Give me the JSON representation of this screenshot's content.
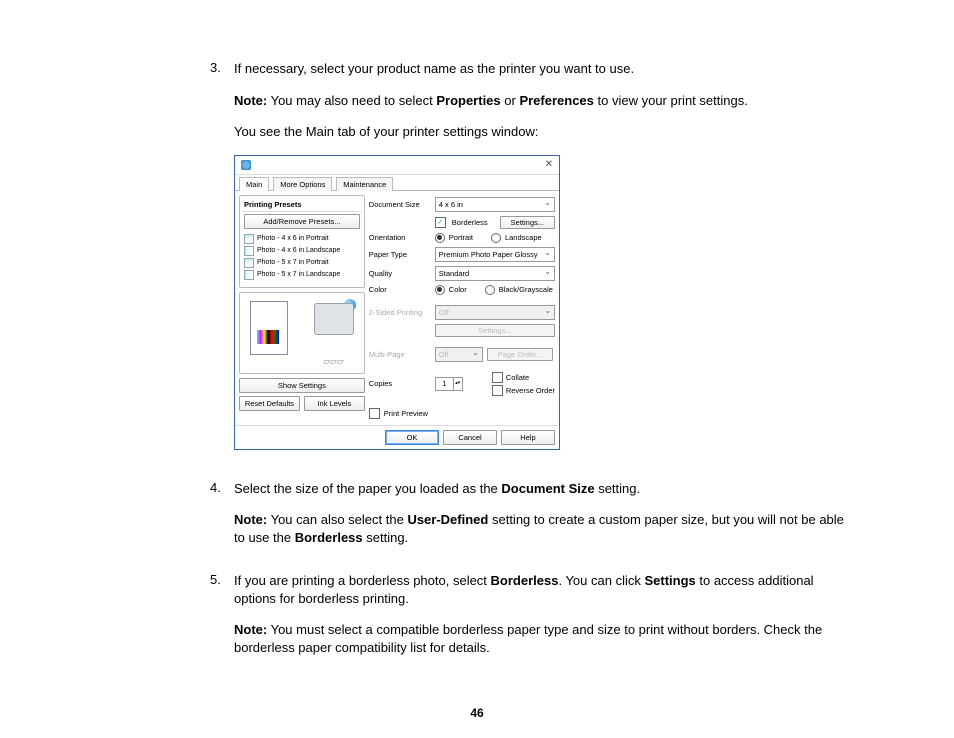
{
  "steps": {
    "s3": {
      "num": "3.",
      "text": "If necessary, select your product name as the printer you want to use.",
      "note_label": "Note:",
      "note_a": " You may also need to select ",
      "note_b": "Properties",
      "note_c": " or ",
      "note_d": "Preferences",
      "note_e": " to view your print settings.",
      "after": "You see the Main tab of your printer settings window:"
    },
    "s4": {
      "num": "4.",
      "text_a": "Select the size of the paper you loaded as the ",
      "text_b": "Document Size",
      "text_c": " setting.",
      "note_label": "Note:",
      "note_a": " You can also select the ",
      "note_b": "User-Defined",
      "note_c": " setting to create a custom paper size, but you will not be able to use the ",
      "note_d": "Borderless",
      "note_e": " setting."
    },
    "s5": {
      "num": "5.",
      "text_a": "If you are printing a borderless photo, select ",
      "text_b": "Borderless",
      "text_c": ". You can click ",
      "text_d": "Settings",
      "text_e": " to access additional options for borderless printing.",
      "note_label": "Note:",
      "note_a": " You must select a compatible borderless paper type and size to print without borders. Check the borderless paper compatibility list for details."
    }
  },
  "dialog": {
    "tabs": {
      "main": "Main",
      "more": "More Options",
      "maint": "Maintenance"
    },
    "presets_title": "Printing Presets",
    "add_remove": "Add/Remove Presets...",
    "presets": [
      "Photo - 4 x 6 in Portrait",
      "Photo - 4 x 6 in Landscape",
      "Photo - 5 x 7 in Portrait",
      "Photo - 5 x 7 in Landscape"
    ],
    "show_settings": "Show Settings",
    "reset_defaults": "Reset Defaults",
    "ink_levels": "Ink Levels",
    "labels": {
      "doc_size": "Document Size",
      "borderless": "Borderless",
      "settings": "Settings...",
      "orientation": "Orientation",
      "portrait": "Portrait",
      "landscape": "Landscape",
      "paper_type": "Paper Type",
      "quality": "Quality",
      "color": "Color",
      "color_opt": "Color",
      "bw_opt": "Black/Grayscale",
      "twosided": "2-Sided Printing",
      "multipage": "Multi-Page",
      "page_order": "Page Order...",
      "copies": "Copies",
      "collate": "Collate",
      "reverse": "Reverse Order",
      "preview": "Print Preview"
    },
    "values": {
      "doc_size": "4 x 6 in",
      "paper_type": "Premium Photo Paper Glossy",
      "quality": "Standard",
      "twosided": "Off",
      "multipage": "Off",
      "copies": "1",
      "settings_dis": "Settings..."
    },
    "footer": {
      "ok": "OK",
      "cancel": "Cancel",
      "help": "Help"
    }
  },
  "page_number": "46"
}
